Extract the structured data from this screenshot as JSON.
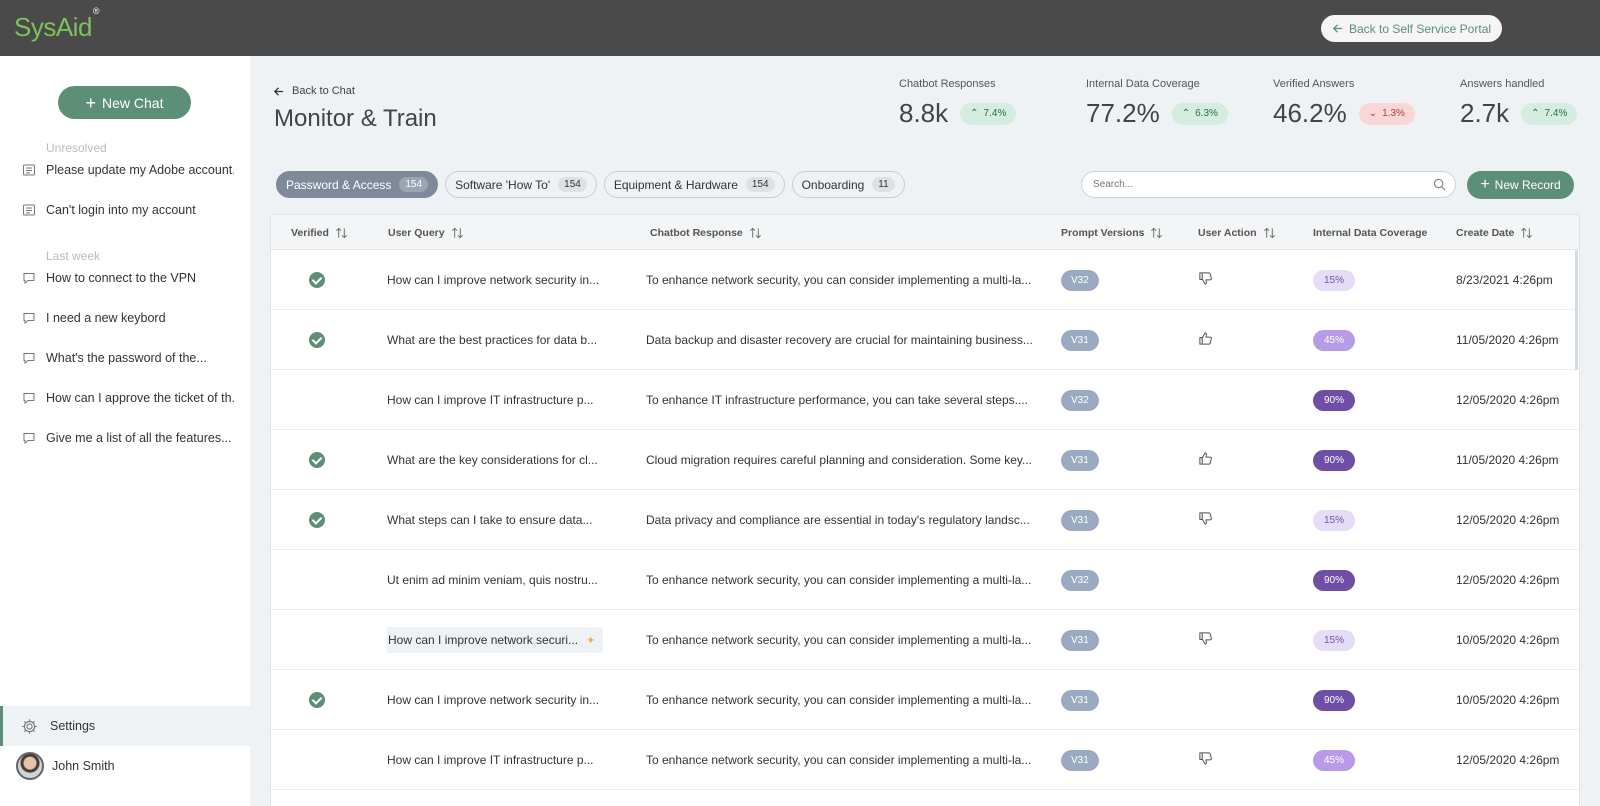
{
  "app": {
    "logo": "SysAid",
    "logo_mark": "®",
    "back_portal": "Back to Self Service Portal"
  },
  "sidebar": {
    "new_chat": "New Chat",
    "sections": [
      {
        "label": "Unresolved",
        "items": [
          "Please update my Adobe account...",
          "Can't login into my account"
        ]
      },
      {
        "label": "Last week",
        "items": [
          "How to connect to the VPN",
          "I need a new keybord",
          "What's the password of the...",
          "How can I approve the ticket of th...",
          "Give me a list of all the features..."
        ]
      }
    ],
    "settings": "Settings",
    "user": "John Smith"
  },
  "header": {
    "back": "Back to Chat",
    "title": "Monitor & Train",
    "stats": [
      {
        "label": "Chatbot Responses",
        "value": "8.8k",
        "delta": "7.4%",
        "dir": "up"
      },
      {
        "label": "Internal Data Coverage",
        "value": "77.2%",
        "delta": "6.3%",
        "dir": "up"
      },
      {
        "label": "Verified Answers",
        "value": "46.2%",
        "delta": "1.3%",
        "dir": "down"
      },
      {
        "label": "Answers handled",
        "value": "2.7k",
        "delta": "7.4%",
        "dir": "up"
      }
    ]
  },
  "tabs": [
    {
      "label": "Password & Access",
      "count": "154"
    },
    {
      "label": "Software 'How To'",
      "count": "154"
    },
    {
      "label": "Equipment & Hardware",
      "count": "154"
    },
    {
      "label": "Onboarding",
      "count": "11"
    }
  ],
  "search": {
    "placeholder": "Search..."
  },
  "new_record": "New Record",
  "table": {
    "columns": [
      "Verified",
      "User Query",
      "Chatbot Response",
      "Prompt Versions",
      "User Action",
      "Internal Data Coverage",
      "Create Date"
    ],
    "rows": [
      {
        "verified": true,
        "query": "How can I improve network security in...",
        "response": "To enhance network security, you can consider implementing a multi-la...",
        "version": "V32",
        "action": "thumbs-down",
        "coverage": "15%",
        "date": "8/23/2021 4:26pm"
      },
      {
        "verified": true,
        "query": "What are the best practices for data b...",
        "response": "Data backup and disaster recovery are crucial for maintaining business...",
        "version": "V31",
        "action": "thumbs-up",
        "coverage": "45%",
        "date": "11/05/2020 4:26pm"
      },
      {
        "verified": false,
        "query": "How can I improve IT infrastructure p...",
        "response": "To enhance IT infrastructure performance, you can take several steps....",
        "version": "V32",
        "action": "",
        "coverage": "90%",
        "date": "12/05/2020 4:26pm"
      },
      {
        "verified": true,
        "query": "What are the key considerations for cl...",
        "response": "Cloud migration requires careful planning and consideration. Some key...",
        "version": "V31",
        "action": "thumbs-up",
        "coverage": "90%",
        "date": "11/05/2020 4:26pm"
      },
      {
        "verified": true,
        "query": "What steps can I take to ensure data...",
        "response": "Data privacy and compliance are essential in today's regulatory landsc...",
        "version": "V31",
        "action": "thumbs-down",
        "coverage": "15%",
        "date": "12/05/2020 4:26pm"
      },
      {
        "verified": false,
        "query": "Ut enim ad minim veniam, quis nostru...",
        "response": "To enhance network security, you can consider implementing a multi-la...",
        "version": "V32",
        "action": "",
        "coverage": "90%",
        "date": "12/05/2020 4:26pm"
      },
      {
        "verified": false,
        "query": "How can I improve network securi...",
        "response": "To enhance network security, you can consider implementing a multi-la...",
        "version": "V31",
        "action": "thumbs-down",
        "coverage": "15%",
        "date": "10/05/2020 4:26pm",
        "highlight": true
      },
      {
        "verified": true,
        "query": "How can I improve network security in...",
        "response": "To enhance network security, you can consider implementing a multi-la...",
        "version": "V31",
        "action": "",
        "coverage": "90%",
        "date": "10/05/2020 4:26pm"
      },
      {
        "verified": false,
        "query": "How can I improve IT infrastructure p...",
        "response": "To enhance network security, you can consider implementing a multi-la...",
        "version": "V31",
        "action": "thumbs-down",
        "coverage": "45%",
        "date": "12/05/2020 4:26pm"
      }
    ]
  },
  "colors": {
    "accent": "#5d8e78",
    "topbar": "#4a4a4a",
    "tab_active": "#7e8a9a",
    "coverage_low": "#e5dcf7",
    "coverage_mid": "#b89be6",
    "coverage_high": "#6e4fa5"
  }
}
